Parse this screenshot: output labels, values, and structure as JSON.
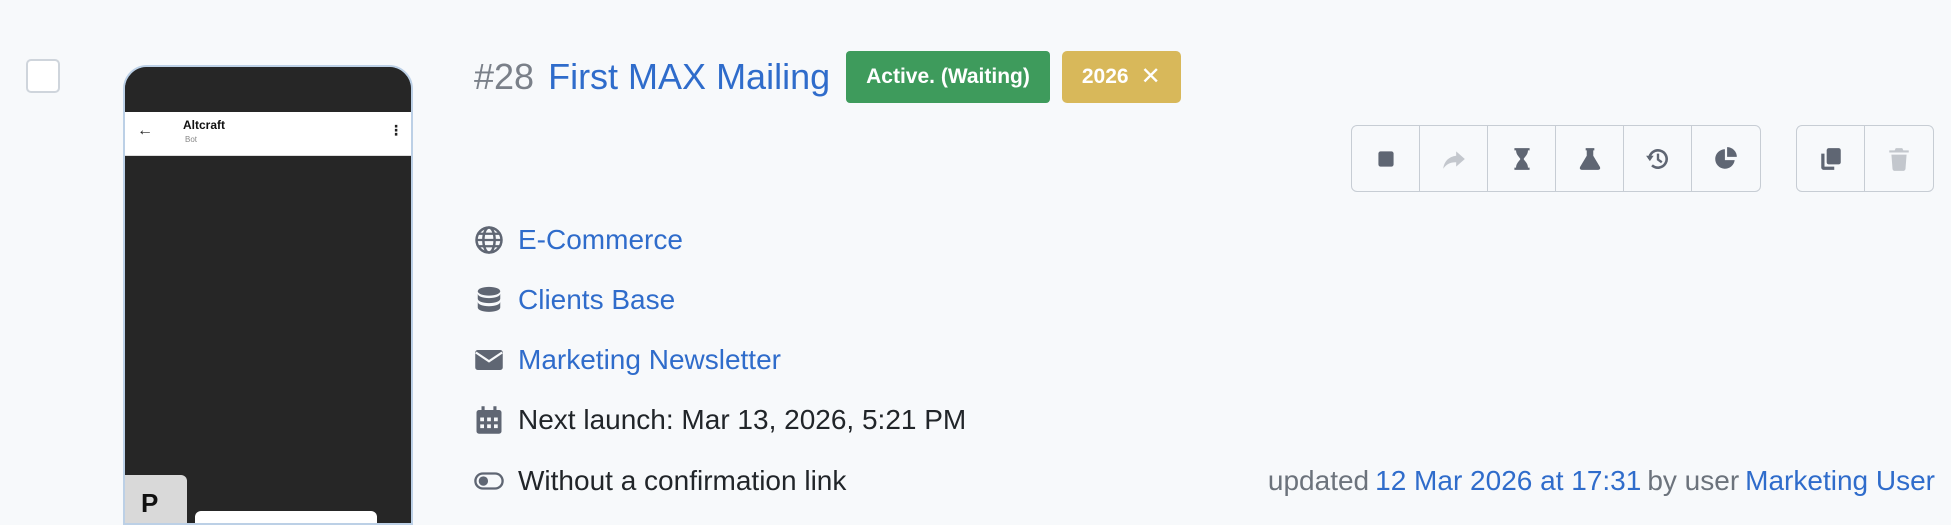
{
  "campaign": {
    "number": "#28",
    "name": "First MAX Mailing",
    "status_badge": "Active. (Waiting)",
    "tag": "2026",
    "tag_remove_glyph": "✕"
  },
  "preview": {
    "chat_title": "Altcraft",
    "chat_subtitle": "Bot",
    "back_glyph": "←",
    "menu_glyph": "⋮",
    "tile_glyph": "P"
  },
  "actions": [
    {
      "name": "stop-button",
      "icon": "stop-icon"
    },
    {
      "name": "forward-button",
      "icon": "share-icon",
      "disabled": true
    },
    {
      "name": "schedule-button",
      "icon": "hourglass-icon"
    },
    {
      "name": "test-button",
      "icon": "flask-icon"
    },
    {
      "name": "history-button",
      "icon": "history-icon"
    },
    {
      "name": "stats-button",
      "icon": "pie-chart-icon"
    },
    {
      "name": "copy-button",
      "icon": "copy-icon"
    },
    {
      "name": "delete-button",
      "icon": "trash-icon",
      "disabled": true
    }
  ],
  "details": {
    "resource": "E-Commerce",
    "database": "Clients Base",
    "template": "Marketing Newsletter",
    "next_launch": "Next launch: Mar 13, 2026, 5:21 PM",
    "confirmation": "Without a confirmation link"
  },
  "updated": {
    "prefix": "updated",
    "date": "12 Mar 2026 at 17:31",
    "by": "by user",
    "user": "Marketing User"
  },
  "colors": {
    "link": "#2f6ccb",
    "status_active": "#3e9b5c",
    "tag": "#d8b85a",
    "icon": "#5f6673",
    "icon_disabled": "#c3c7cd"
  }
}
